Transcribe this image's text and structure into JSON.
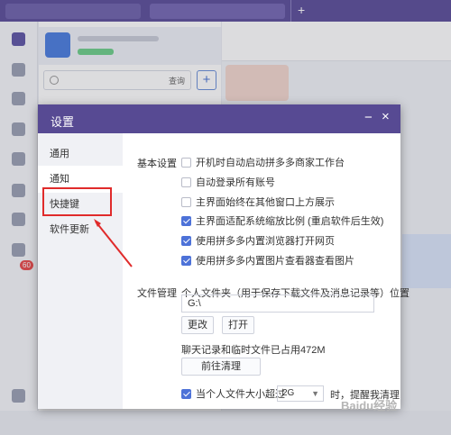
{
  "background_app": {
    "search_label": "查询",
    "add_label": "+",
    "new_tab_label": "+",
    "sidebar_badge": "60"
  },
  "dialog": {
    "title": "设置",
    "minimize_label": "−",
    "close_label": "×",
    "nav": [
      {
        "label": "通用"
      },
      {
        "label": "通知"
      },
      {
        "label": "快捷键"
      },
      {
        "label": "软件更新"
      }
    ],
    "basic": {
      "section_label": "基本设置",
      "options": [
        {
          "label": "开机时自动启动拼多多商家工作台",
          "checked": false
        },
        {
          "label": "自动登录所有账号",
          "checked": false
        },
        {
          "label": "主界面始终在其他窗口上方展示",
          "checked": false
        },
        {
          "label": "主界面适配系统缩放比例 (重启软件后生效)",
          "checked": true
        },
        {
          "label": "使用拼多多内置浏览器打开网页",
          "checked": true
        },
        {
          "label": "使用拼多多内置图片查看器查看图片",
          "checked": true
        }
      ]
    },
    "files": {
      "section_label": "文件管理",
      "folder_desc": "个人文件夹（用于保存下载文件及消息记录等）位置",
      "folder_path": "G:\\",
      "change_button": "更改",
      "open_button": "打开",
      "usage_text": "聊天记录和临时文件已占用472M",
      "clean_button": "前往清理",
      "limit_prefix": "当个人文件大小超过",
      "limit_value": "2G",
      "limit_suffix": "时，提醒我清理",
      "limit_checked": true
    }
  },
  "watermark": "Baidu经验"
}
